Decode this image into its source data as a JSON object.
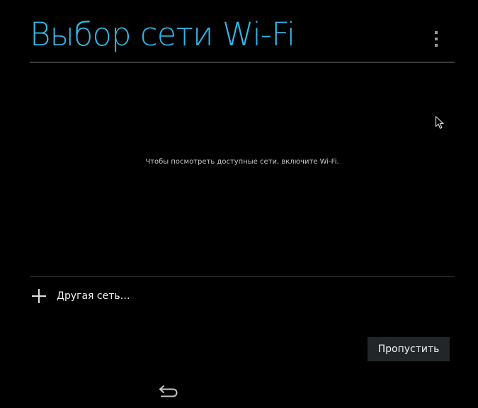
{
  "header": {
    "title": "Выбор сети Wi-Fi",
    "menu_icon": "overflow-menu-icon"
  },
  "colors": {
    "accent": "#33b5e5",
    "background": "#000000",
    "button_bg": "#222629"
  },
  "network_list": {
    "empty_message": "Чтобы посмотреть доступные сети, включите Wi-Fi."
  },
  "other_network": {
    "icon": "plus-icon",
    "label": "Другая сеть…"
  },
  "footer": {
    "skip_label": "Пропустить"
  },
  "nav_bar": {
    "back_icon": "back-icon"
  }
}
